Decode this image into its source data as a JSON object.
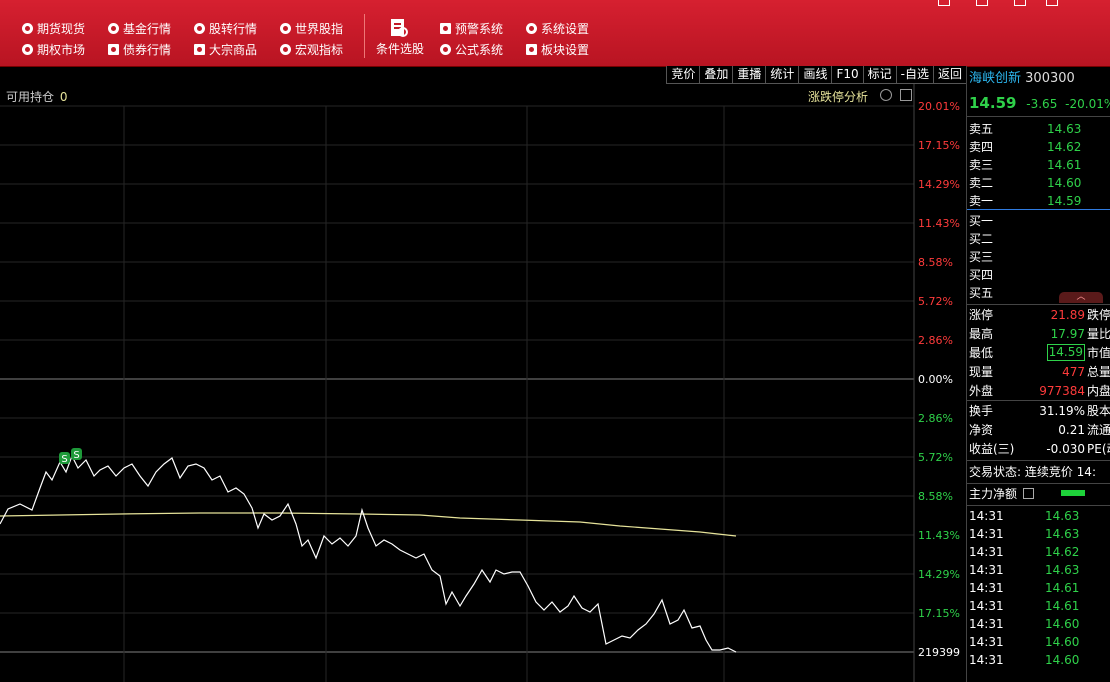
{
  "menu": {
    "row1": [
      {
        "label": "期货现货",
        "icon": "futures-icon"
      },
      {
        "label": "基金行情",
        "icon": "fund-icon"
      },
      {
        "label": "股转行情",
        "icon": "share-transfer-icon"
      },
      {
        "label": "世界股指",
        "icon": "globe-icon"
      }
    ],
    "row2": [
      {
        "label": "期权市场",
        "icon": "options-icon"
      },
      {
        "label": "债券行情",
        "icon": "bond-icon"
      },
      {
        "label": "大宗商品",
        "icon": "commodity-icon"
      },
      {
        "label": "宏观指标",
        "icon": "macro-icon"
      }
    ],
    "screener": "条件选股",
    "right_row1": [
      {
        "label": "预警系统",
        "icon": "alarm-icon"
      },
      {
        "label": "系统设置",
        "icon": "tools-icon"
      }
    ],
    "right_row2": [
      {
        "label": "公式系统",
        "icon": "formula-icon"
      },
      {
        "label": "板块设置",
        "icon": "sector-icon"
      }
    ]
  },
  "toolbar": [
    "竞价",
    "叠加",
    "重播",
    "统计",
    "画线",
    "F10",
    "标记",
    "-自选",
    "返回"
  ],
  "chart": {
    "position_label": "可用持仓",
    "position_value": "0",
    "analysis_label": "涨跌停分析",
    "pct_labels": [
      {
        "text": "20.01%",
        "color": "#ff3b3b"
      },
      {
        "text": "17.15%",
        "color": "#ff3b3b"
      },
      {
        "text": "14.29%",
        "color": "#ff3b3b"
      },
      {
        "text": "11.43%",
        "color": "#ff3b3b"
      },
      {
        "text": "8.58%",
        "color": "#ff3b3b"
      },
      {
        "text": "5.72%",
        "color": "#ff3b3b"
      },
      {
        "text": "2.86%",
        "color": "#ff3b3b"
      },
      {
        "text": "0.00%",
        "color": "#ffffff"
      },
      {
        "text": "2.86%",
        "color": "#2fd24a"
      },
      {
        "text": "5.72%",
        "color": "#2fd24a"
      },
      {
        "text": "8.58%",
        "color": "#2fd24a"
      },
      {
        "text": "11.43%",
        "color": "#2fd24a"
      },
      {
        "text": "14.29%",
        "color": "#2fd24a"
      },
      {
        "text": "17.15%",
        "color": "#2fd24a"
      }
    ],
    "volume_label": "219399",
    "signal_marks": [
      "S",
      "S"
    ]
  },
  "quote": {
    "name": "海峡创新",
    "code": "300300",
    "price": "14.59",
    "change": "-3.65",
    "change_pct": "-20.01%",
    "asks": [
      {
        "label": "卖五",
        "price": "14.63"
      },
      {
        "label": "卖四",
        "price": "14.62"
      },
      {
        "label": "卖三",
        "price": "14.61"
      },
      {
        "label": "卖二",
        "price": "14.60"
      },
      {
        "label": "卖一",
        "price": "14.59"
      }
    ],
    "bids": [
      {
        "label": "买一"
      },
      {
        "label": "买二"
      },
      {
        "label": "买三"
      },
      {
        "label": "买四"
      },
      {
        "label": "买五"
      }
    ],
    "stats": [
      {
        "label": "涨停",
        "value": "21.89",
        "color": "#ff3b3b",
        "side": "跌停"
      },
      {
        "label": "最高",
        "value": "17.97",
        "color": "#2fd24a",
        "side": "量比"
      },
      {
        "label": "最低",
        "value": "14.59",
        "color": "#2fd24a",
        "side": "市值",
        "boxed": true
      },
      {
        "label": "现量",
        "value": "477",
        "color": "#ff3b3b",
        "side": "总量"
      },
      {
        "label": "外盘",
        "value": "977384",
        "color": "#ff3b3b",
        "side": "内盘"
      }
    ],
    "stats2": [
      {
        "label": "换手",
        "value": "31.19%",
        "side": "股本"
      },
      {
        "label": "净资",
        "value": "0.21",
        "side": "流通"
      },
      {
        "label": "收益(三)",
        "value": "-0.030",
        "side": "PE(动"
      }
    ],
    "trade_status": "交易状态: 连续竞价 14:",
    "main_net": "主力净额",
    "ticks": [
      {
        "time": "14:31",
        "price": "14.63"
      },
      {
        "time": "14:31",
        "price": "14.63"
      },
      {
        "time": "14:31",
        "price": "14.62"
      },
      {
        "time": "14:31",
        "price": "14.63"
      },
      {
        "time": "14:31",
        "price": "14.61"
      },
      {
        "time": "14:31",
        "price": "14.61"
      },
      {
        "time": "14:31",
        "price": "14.60"
      },
      {
        "time": "14:31",
        "price": "14.60"
      },
      {
        "time": "14:31",
        "price": "14.60"
      }
    ]
  },
  "colors": {
    "up": "#ff3b3b",
    "down": "#2fd24a",
    "accent": "#2cb6ee",
    "menu_bg": "#c11a28",
    "avg_line": "#e6e39a"
  }
}
